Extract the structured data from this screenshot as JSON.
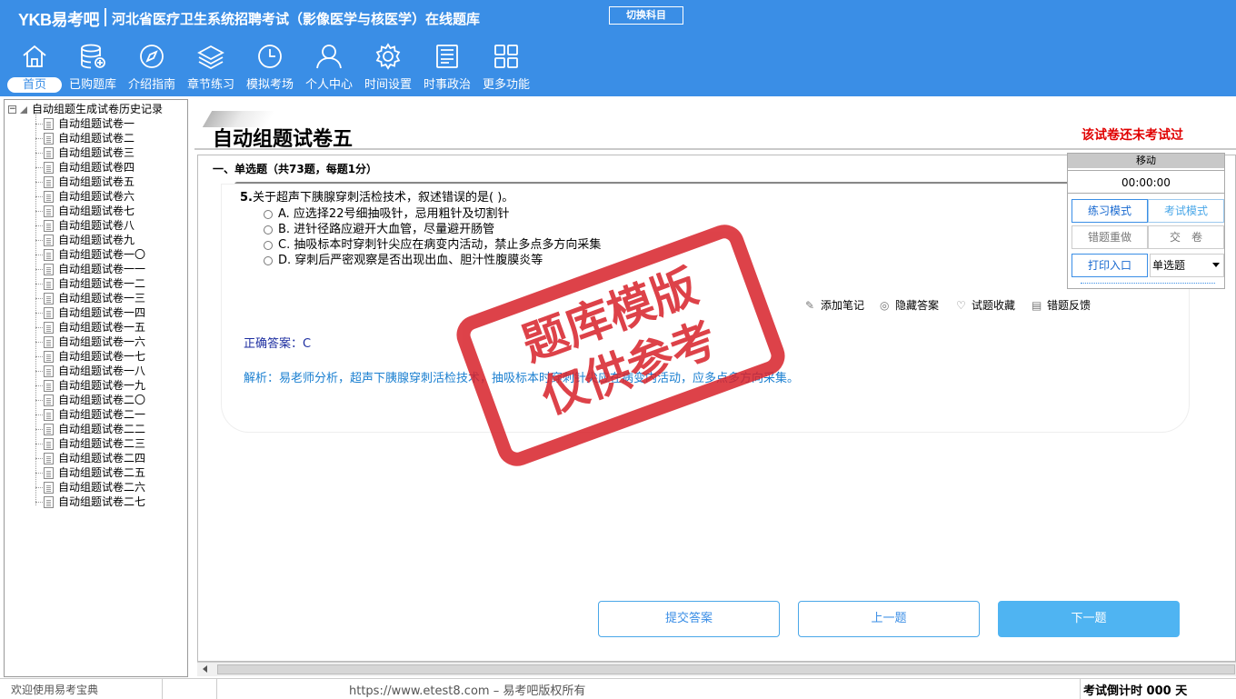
{
  "header": {
    "brand": "YKB易考吧",
    "title": "河北省医疗卫生系统招聘考试（影像医学与核医学）在线题库",
    "switch_button": "切换科目"
  },
  "nav": [
    {
      "label": "首页",
      "icon": "home-icon",
      "active": true
    },
    {
      "label": "已购题库",
      "icon": "database-icon"
    },
    {
      "label": "介绍指南",
      "icon": "compass-icon"
    },
    {
      "label": "章节练习",
      "icon": "layers-icon"
    },
    {
      "label": "模拟考场",
      "icon": "clock-icon"
    },
    {
      "label": "个人中心",
      "icon": "user-icon"
    },
    {
      "label": "时间设置",
      "icon": "gear-icon"
    },
    {
      "label": "时事政治",
      "icon": "newspaper-icon"
    },
    {
      "label": "更多功能",
      "icon": "grid-icon"
    }
  ],
  "tree": {
    "root": "自动组题生成试卷历史记录",
    "items": [
      "自动组题试卷一",
      "自动组题试卷二",
      "自动组题试卷三",
      "自动组题试卷四",
      "自动组题试卷五",
      "自动组题试卷六",
      "自动组题试卷七",
      "自动组题试卷八",
      "自动组题试卷九",
      "自动组题试卷一〇",
      "自动组题试卷一一",
      "自动组题试卷一二",
      "自动组题试卷一三",
      "自动组题试卷一四",
      "自动组题试卷一五",
      "自动组题试卷一六",
      "自动组题试卷一七",
      "自动组题试卷一八",
      "自动组题试卷一九",
      "自动组题试卷二〇",
      "自动组题试卷二一",
      "自动组题试卷二二",
      "自动组题试卷二三",
      "自动组题试卷二四",
      "自动组题试卷二五",
      "自动组题试卷二六",
      "自动组题试卷二七"
    ]
  },
  "paper": {
    "title": "自动组题试卷五",
    "status": "该试卷还未考试过",
    "section": "一、单选题（共73题，每题1分）"
  },
  "question": {
    "number": "5.",
    "stem": "关于超声下胰腺穿刺活检技术，叙述错误的是(    )。",
    "options": [
      "A. 应选择22号细抽吸针，忌用粗针及切割针",
      "B. 进针径路应避开大血管，尽量避开肠管",
      "C. 抽吸标本时穿刺针尖应在病变内活动，禁止多点多方向采集",
      "D. 穿刺后严密观察是否出现出血、胆汁性腹膜炎等"
    ],
    "answer": "正确答案：C",
    "analysis": "解析：易老师分析，超声下胰腺穿刺活检技术，抽吸标本时穿刺针尖应在病变内活动，应多点多方向采集。"
  },
  "tools": {
    "note": "添加笔记",
    "hide": "隐藏答案",
    "fav": "试题收藏",
    "report": "错题反馈"
  },
  "stamp": {
    "line1": "题库模版",
    "line2": "仅供参考"
  },
  "panel": {
    "move": "移动",
    "timer": "00:00:00",
    "practice": "练习模式",
    "exam": "考试模式",
    "redo": "错题重做",
    "submit": "交　卷",
    "print": "打印入口",
    "type": "单选题"
  },
  "buttons": {
    "submit": "提交答案",
    "prev": "上一题",
    "next": "下一题"
  },
  "status": {
    "welcome": "欢迎使用易考宝典",
    "copyright": "https://www.etest8.com – 易考吧版权所有",
    "countdown": "考试倒计时 000 天"
  },
  "colors": {
    "header": "#3a8ee6",
    "stamp": "#d8222a",
    "status_red": "#e00000"
  }
}
